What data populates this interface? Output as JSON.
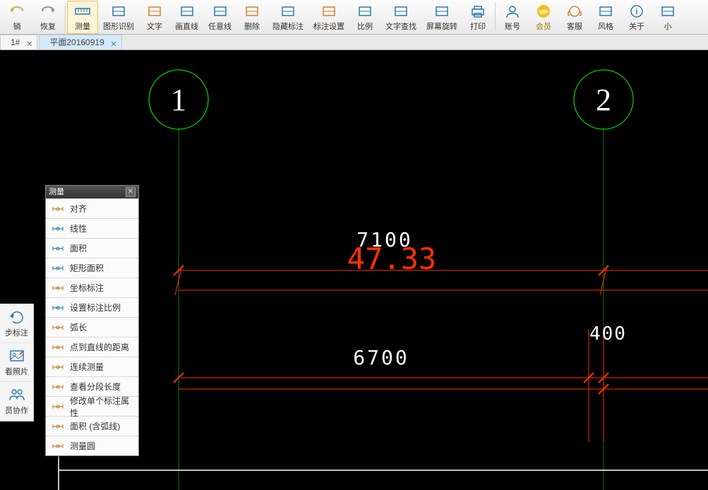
{
  "toolbar": [
    {
      "name": "undo",
      "label": "销",
      "color": "#d4b05a"
    },
    {
      "name": "redo",
      "label": "恢复",
      "color": "#999"
    },
    {
      "name": "measure",
      "label": "测量",
      "color": "#2a7ab0",
      "active": true
    },
    {
      "name": "shape-detect",
      "label": "图形识别",
      "color": "#2a7ab0"
    },
    {
      "name": "text",
      "label": "文字",
      "color": "#d08030"
    },
    {
      "name": "draw-line",
      "label": "画直线",
      "color": "#2a7ab0"
    },
    {
      "name": "free-line",
      "label": "任意线",
      "color": "#2a7ab0"
    },
    {
      "name": "delete",
      "label": "删除",
      "color": "#d08030"
    },
    {
      "name": "hide-annotation",
      "label": "隐藏标注",
      "color": "#2a7ab0"
    },
    {
      "name": "annotation-settings",
      "label": "标注设置",
      "color": "#d08030"
    },
    {
      "name": "scale",
      "label": "比例",
      "color": "#2a7ab0"
    },
    {
      "name": "text-search",
      "label": "文字查找",
      "color": "#2a7ab0"
    },
    {
      "name": "screen-rotate",
      "label": "屏幕旋转",
      "color": "#2a7ab0"
    },
    {
      "name": "print",
      "label": "打印",
      "color": "#2a7ab0"
    },
    {
      "name": "account",
      "label": "账号",
      "color": "#2a7ab0"
    },
    {
      "name": "vip",
      "label": "会员",
      "color": "#d4a000",
      "vip": true
    },
    {
      "name": "support",
      "label": "客服",
      "color": "#d08030"
    },
    {
      "name": "style",
      "label": "风格",
      "color": "#2a7ab0"
    },
    {
      "name": "about",
      "label": "关于",
      "color": "#2a7ab0"
    },
    {
      "name": "mini",
      "label": "小",
      "color": "#2a7ab0"
    }
  ],
  "tabs": [
    {
      "label": "1#",
      "active": false
    },
    {
      "label": "平面20160919",
      "active": true
    }
  ],
  "dock": [
    {
      "name": "sync-annotation",
      "label": "步标注"
    },
    {
      "name": "view-photo",
      "label": "看照片"
    },
    {
      "name": "team-collab",
      "label": "员协作"
    }
  ],
  "measurePanel": {
    "title": "测量",
    "items": [
      {
        "name": "align",
        "label": "对齐"
      },
      {
        "name": "linear",
        "label": "线性"
      },
      {
        "name": "area",
        "label": "面积"
      },
      {
        "name": "rect-area",
        "label": "矩形面积"
      },
      {
        "name": "coord-annotation",
        "label": "坐标标注"
      },
      {
        "name": "set-scale",
        "label": "设置标注比例"
      },
      {
        "name": "arc-length",
        "label": "弧长"
      },
      {
        "name": "point-to-line",
        "label": "点到直线的距离"
      },
      {
        "name": "continuous",
        "label": "连续测量"
      },
      {
        "name": "segment-length",
        "label": "查看分段长度"
      },
      {
        "name": "edit-annotation",
        "label": "修改单个标注属性"
      },
      {
        "name": "area-arc",
        "label": "面积 (含弧线)"
      },
      {
        "name": "measure-circle",
        "label": "测量圆"
      }
    ]
  },
  "drawing": {
    "grid1": "1",
    "grid2": "2",
    "dim1": "7100",
    "dim2": "6700",
    "dim3": "400",
    "measurement": "47.33"
  }
}
